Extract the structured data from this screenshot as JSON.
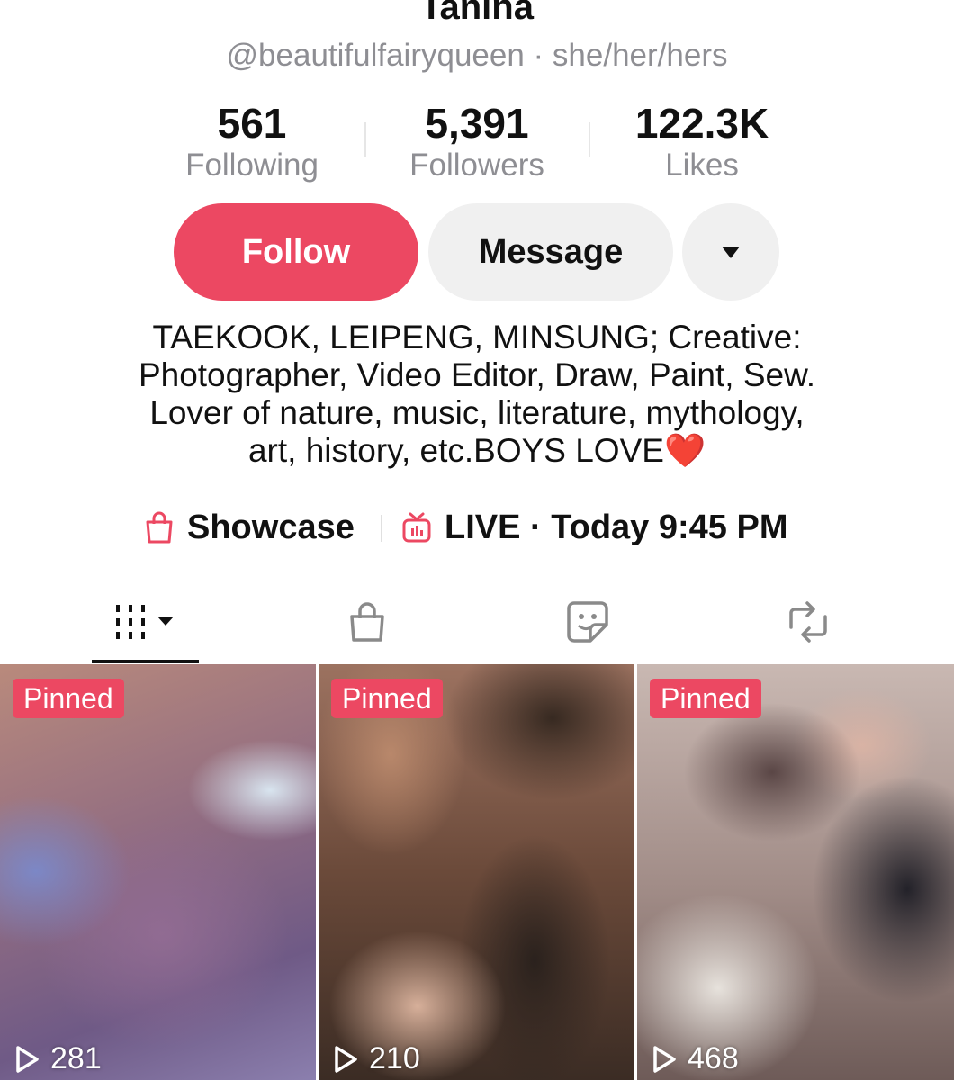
{
  "profile": {
    "name": "Tanina",
    "handle_line": "@beautifulfairyqueen · she/her/hers"
  },
  "stats": [
    {
      "value": "561",
      "label": "Following"
    },
    {
      "value": "5,391",
      "label": "Followers"
    },
    {
      "value": "122.3K",
      "label": "Likes"
    }
  ],
  "actions": {
    "follow_label": "Follow",
    "message_label": "Message",
    "more_icon": "caret-down-icon"
  },
  "bio": {
    "lines": [
      "TAEKOOK, LEIPENG, MINSUNG; Creative:",
      "Photographer, Video Editor, Draw, Paint, Sew.",
      "Lover of nature, music, literature, mythology,",
      "art, history, etc.BOYS LOVE❤️"
    ]
  },
  "links": {
    "showcase_label": "Showcase",
    "showcase_icon": "shopping-bag-icon",
    "live_label": "LIVE · Today 9:45 PM",
    "live_icon": "tv-icon",
    "accent_color": "#ec4862"
  },
  "tabs": [
    {
      "name": "videos-grid",
      "icon": "grid-icon",
      "active": true
    },
    {
      "name": "shop",
      "icon": "shopping-bag-icon",
      "active": false
    },
    {
      "name": "stickers",
      "icon": "sticker-icon",
      "active": false
    },
    {
      "name": "reposts",
      "icon": "repost-icon",
      "active": false
    }
  ],
  "videos": [
    {
      "badge": "Pinned",
      "views": "281"
    },
    {
      "badge": "Pinned",
      "views": "210"
    },
    {
      "badge": "Pinned",
      "views": "468"
    }
  ]
}
